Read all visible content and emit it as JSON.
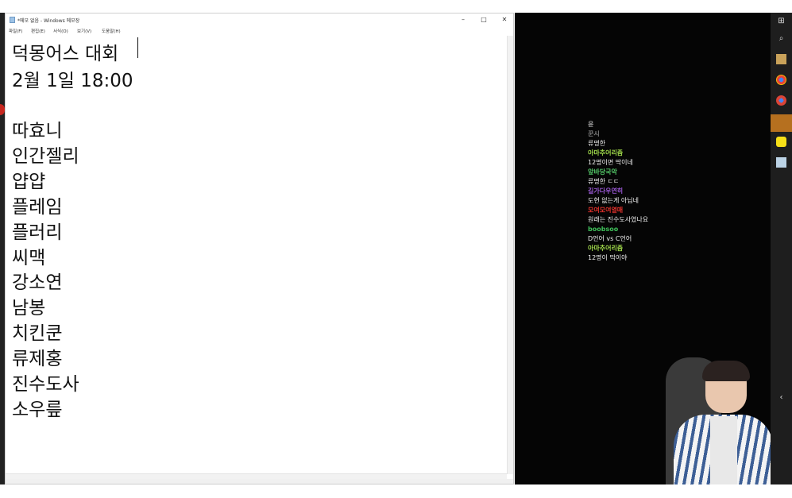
{
  "window": {
    "title": "*메모 없음 - Windows 메모장",
    "controls": {
      "minimize": "–",
      "maximize": "□",
      "close": "✕"
    }
  },
  "menu": [
    "파일(F)",
    "편집(E)",
    "서식(O)",
    "보기(V)",
    "도움말(H)"
  ],
  "document": {
    "lines": [
      "덕몽어스 대회",
      "2월 1일 18:00",
      "",
      "따효니",
      "인간젤리",
      "얍얍",
      "플레임",
      "플러리",
      "씨맥",
      "강소연",
      "남봉",
      "치킨쿤",
      "류제홍",
      "진수도사",
      "소우릎"
    ]
  },
  "chat": [
    {
      "user": "윤",
      "message": "",
      "color": "#9a9a9a"
    },
    {
      "user": "꾼시",
      "message": "류명한",
      "color": "#7f7f7f"
    },
    {
      "user": "아마추어리즘",
      "message": "12명이면 딱이네",
      "color": "#9fd84a"
    },
    {
      "user": "앞바당국악",
      "message": "류명한 ㄷㄷ",
      "color": "#52c466"
    },
    {
      "user": "길가다우연히",
      "message": "도현 없는게 아닙네",
      "color": "#9b59d6"
    },
    {
      "user": "모여모여열매",
      "message": "원래는 진수도사였나요",
      "color": "#e0312b"
    },
    {
      "user": "boobsoo",
      "message": "D언어 vs C언어",
      "color": "#3fbf5a"
    },
    {
      "user": "아마추어리즘",
      "message": "12명이 딱이야",
      "color": "#9fd84a"
    }
  ],
  "taskbar": {
    "icons": [
      "windows-icon",
      "search-icon",
      "notepad-icon",
      "chrome-icon",
      "chrome-profile-icon",
      "app-icon",
      "kakaotalk-icon",
      "document-icon"
    ],
    "tray": [
      "chevron-left-icon",
      "tray-text-1",
      "tray-text-2"
    ]
  },
  "colors": {
    "chat_bg": "#050505",
    "taskbar_bg": "#1e1e1e"
  }
}
